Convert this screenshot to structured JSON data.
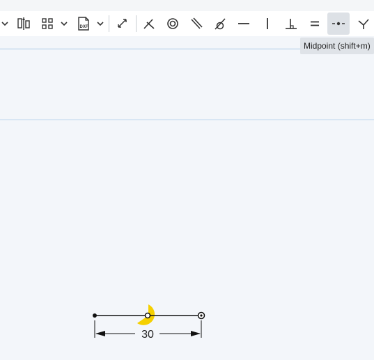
{
  "toolbar": {
    "tools": [
      {
        "name": "dropdown-chevron-icon"
      },
      {
        "name": "sketch-mirror-icon"
      },
      {
        "name": "grid-pattern-icon"
      },
      {
        "name": "dropdown-chevron-icon"
      },
      {
        "name": "dxf-import-icon",
        "label": "DXF"
      },
      {
        "name": "dropdown-chevron-icon"
      },
      {
        "name": "transform-icon"
      },
      {
        "name": "coincident-icon"
      },
      {
        "name": "concentric-icon"
      },
      {
        "name": "parallel-icon"
      },
      {
        "name": "tangent-icon"
      },
      {
        "name": "horizontal-icon"
      },
      {
        "name": "vertical-icon"
      },
      {
        "name": "perpendicular-icon"
      },
      {
        "name": "equal-icon"
      },
      {
        "name": "midpoint-icon",
        "active": true
      },
      {
        "name": "normal-icon"
      }
    ],
    "dxf_label": "DXF",
    "equal_label": "="
  },
  "tooltip": {
    "text": "Midpoint (shift+m)"
  },
  "sketch": {
    "dimension_value": "30",
    "highlight_color": "#f5d000",
    "line_color": "#111111"
  }
}
